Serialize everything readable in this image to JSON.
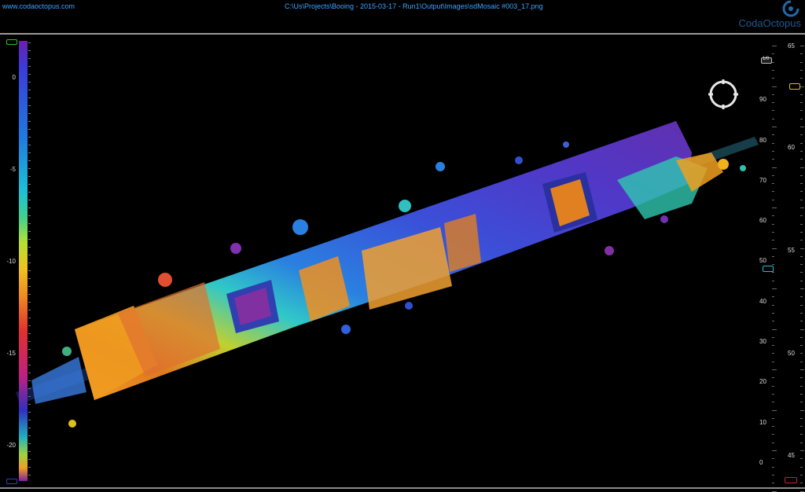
{
  "header": {
    "site_link": "www.codaoctopus.com",
    "file_path": "C:\\Us\\Projects\\Booing - 2015-03-17 - Run1\\Output\\Images\\sdMosaic #003_17.png",
    "brand": "CodaOctopus"
  },
  "depth_scale": {
    "labels": [
      "0",
      "-5",
      "-10",
      "-15",
      "-20"
    ]
  },
  "right_ruler": {
    "inner_labels": [
      "90",
      "80",
      "70",
      "60",
      "50",
      "40",
      "30",
      "20",
      "10",
      "0"
    ],
    "outer_labels": [
      "65",
      "60",
      "55",
      "50",
      "45"
    ],
    "top_badge": "1/0"
  },
  "colors": {
    "accent": "#3fa3ff",
    "marker_green": "#2fbf2f",
    "marker_yellow": "#d4c020",
    "marker_cyan": "#20c0d0",
    "marker_red": "#d02020",
    "marker_blue": "#2a3fd0"
  },
  "compass": {
    "icon": "compass-icon"
  }
}
